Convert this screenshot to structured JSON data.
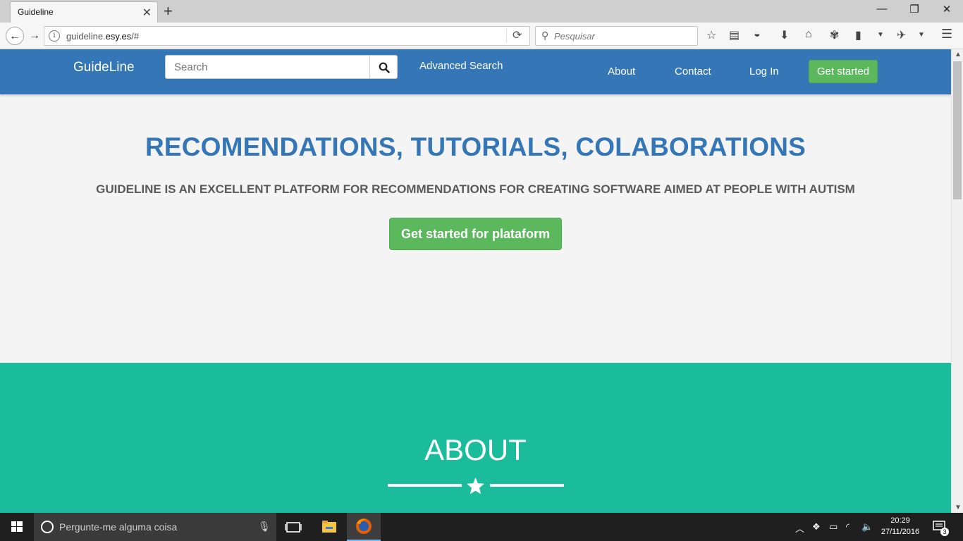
{
  "browser": {
    "tab_title": "Guideline",
    "url_host": "guideline.",
    "url_domain": "esy.es",
    "url_path": "/#",
    "search_placeholder": "Pesquisar"
  },
  "site": {
    "brand": "GuideLine",
    "search_placeholder": "Search",
    "advanced_search": "Advanced Search",
    "nav": {
      "about": "About",
      "contact": "Contact",
      "login": "Log In",
      "get_started": "Get started"
    }
  },
  "hero": {
    "title": "RECOMENDATIONS, TUTORIALS, COLABORATIONS",
    "subtitle": "GUIDELINE IS AN EXCELLENT PLATFORM FOR RECOMMENDATIONS FOR CREATING SOFTWARE AIMED AT PEOPLE WITH AUTISM",
    "button": "Get started for plataform"
  },
  "about": {
    "title": "ABOUT"
  },
  "taskbar": {
    "search_text": "Pergunte-me alguma coisa",
    "time": "20:29",
    "date": "27/11/2016",
    "notification_count": "3"
  },
  "colors": {
    "site_nav": "#3577b6",
    "accent_green": "#5cb85c",
    "about_bg": "#1abc9c"
  }
}
